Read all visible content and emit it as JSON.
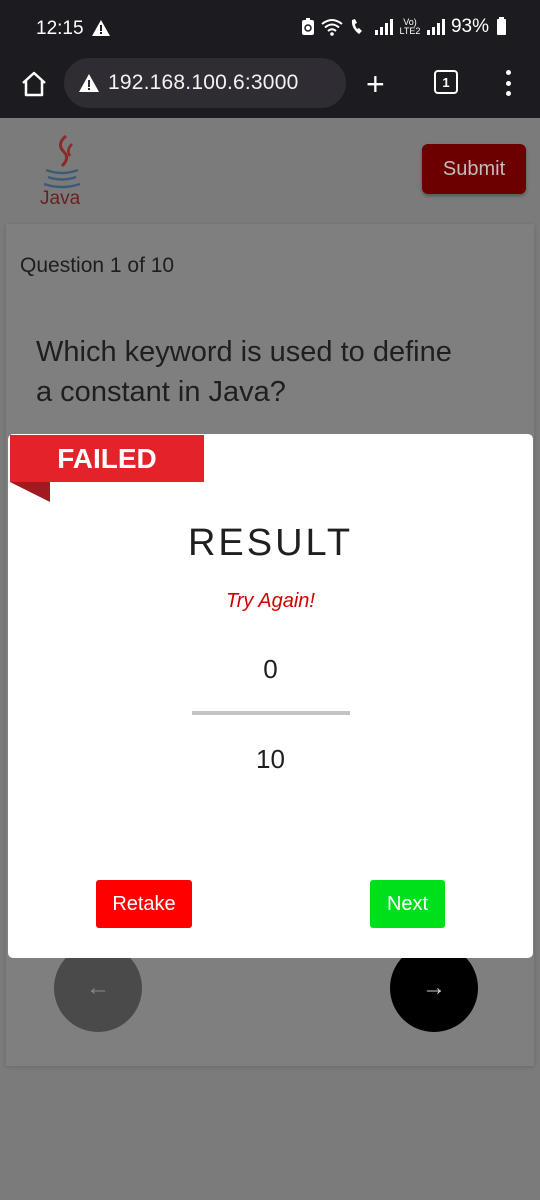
{
  "status_bar": {
    "time": "12:15",
    "battery": "93%",
    "network_label": "Vo) LTE2"
  },
  "browser": {
    "url": "192.168.100.6:3000",
    "tab_count": "1",
    "new_tab_symbol": "+"
  },
  "page": {
    "logo_text": "Java",
    "submit_label": "Submit",
    "question_counter": "Question 1 of 10",
    "question_text": "Which keyword is used to define a constant in Java?",
    "prev_arrow": "←",
    "next_arrow": "→"
  },
  "result_modal": {
    "ribbon_label": "FAILED",
    "title": "RESULT",
    "message": "Try Again!",
    "score": "0",
    "total": "10",
    "retake_label": "Retake",
    "next_label": "Next"
  },
  "colors": {
    "failed_red": "#e3222a",
    "retake_red": "#ff0000",
    "next_green": "#00e01a",
    "message_red": "#d10000",
    "submit_dark_red": "#6c0000"
  }
}
